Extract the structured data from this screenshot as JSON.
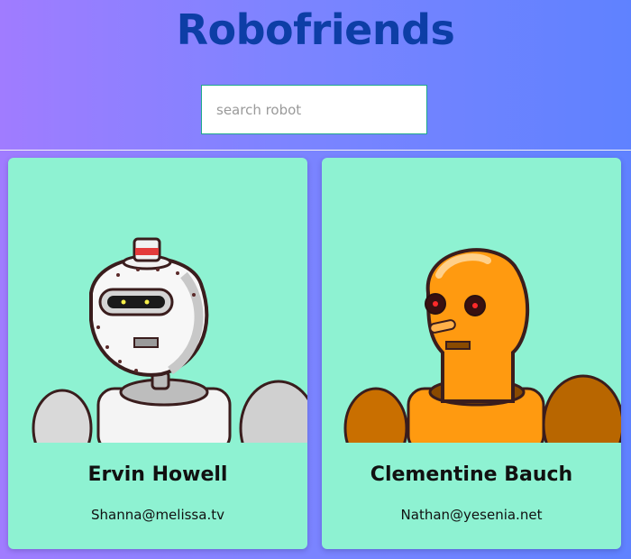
{
  "header": {
    "title": "Robofriends"
  },
  "search": {
    "placeholder": "search robot",
    "value": ""
  },
  "robots": [
    {
      "name": "Ervin Howell",
      "email": "Shanna@melissa.tv",
      "color": "#f2f2f2"
    },
    {
      "name": "Clementine Bauch",
      "email": "Nathan@yesenia.net",
      "color": "#ff9a10"
    }
  ],
  "colors": {
    "title": "#0d3ea6",
    "card": "#8ef2d2",
    "search_border": "#1fa88b"
  }
}
